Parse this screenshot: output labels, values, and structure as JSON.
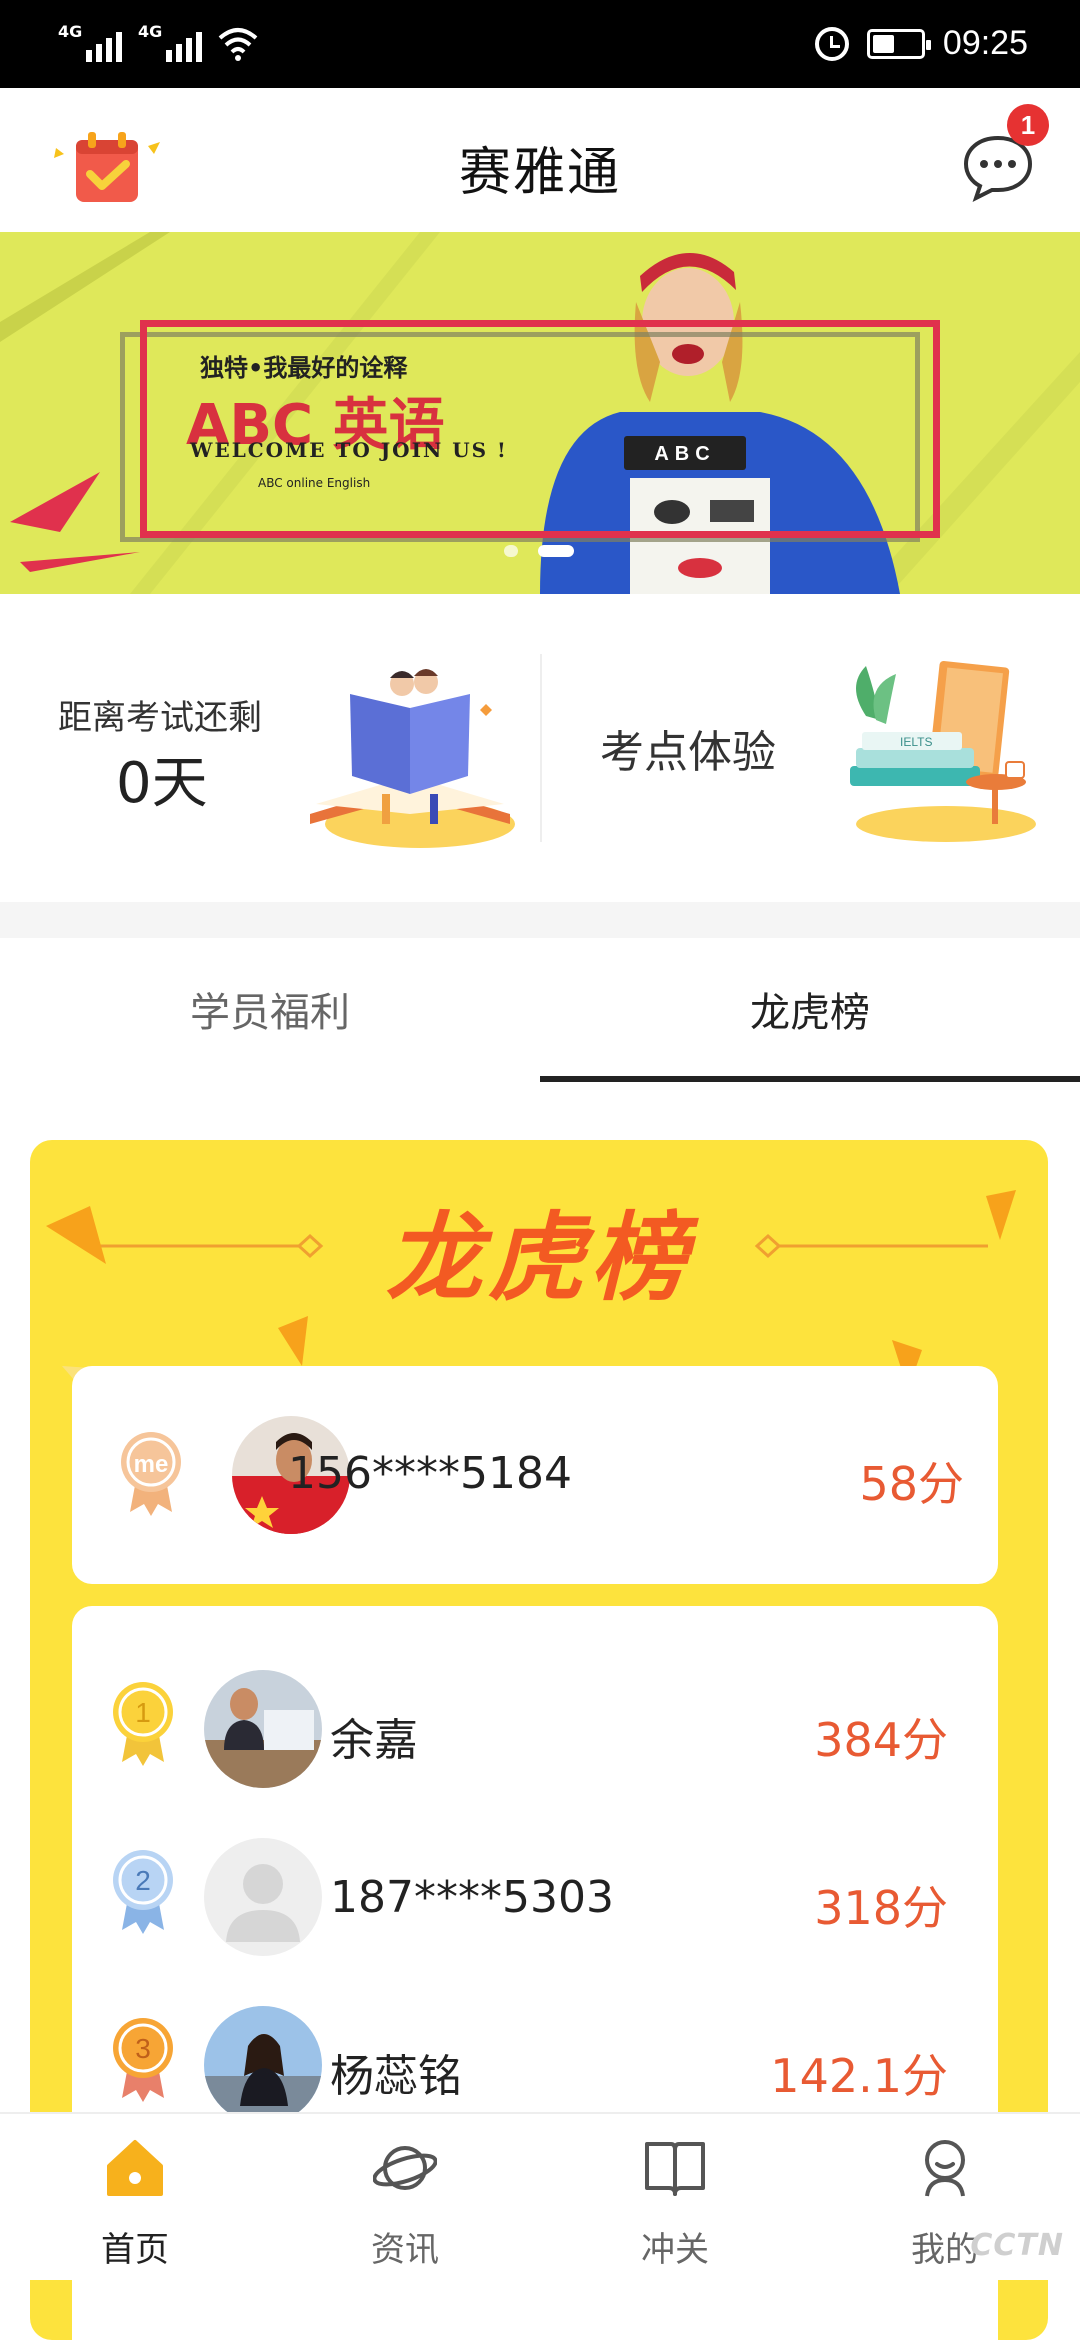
{
  "status_bar": {
    "network1": "4G",
    "network2": "4G",
    "time": "09:25"
  },
  "header": {
    "title": "赛雅通",
    "message_badge": "1",
    "left_icon": "calendar-check-icon",
    "right_icon": "chat-bubble-icon"
  },
  "banner": {
    "subtitle": "独特•我最好的诠释",
    "title": "ABC 英语",
    "welcome": "WELCOME TO JOIN US !",
    "small": "ABC online English",
    "card": "ABC",
    "slide_count": 2,
    "active_slide": 2
  },
  "quick": {
    "countdown_label": "距离考试还剩",
    "countdown_value": "0天",
    "exam_label": "考点体验"
  },
  "tabs": [
    {
      "label": "学员福利"
    },
    {
      "label": "龙虎榜"
    }
  ],
  "active_tab": 1,
  "leaderboard": {
    "title": "龙虎榜",
    "me": {
      "medal": "me",
      "name": "156****5184",
      "score": "58分"
    },
    "entries": [
      {
        "rank": "1",
        "name": "余嘉",
        "score": "384分"
      },
      {
        "rank": "2",
        "name": "187****5303",
        "score": "318分"
      },
      {
        "rank": "3",
        "name": "杨蕊铭",
        "score": "142.1分"
      }
    ]
  },
  "bottom_nav": [
    {
      "label": "首页",
      "icon": "home-icon"
    },
    {
      "label": "资讯",
      "icon": "planet-icon"
    },
    {
      "label": "冲关",
      "icon": "book-icon"
    },
    {
      "label": "我的",
      "icon": "profile-icon"
    }
  ],
  "watermark": "CCTN",
  "colors": {
    "accent": "#f35a22",
    "board_bg": "#fde33d",
    "score": "#e85a33",
    "banner_bg": "#dfe85a",
    "badge": "#e63232"
  }
}
